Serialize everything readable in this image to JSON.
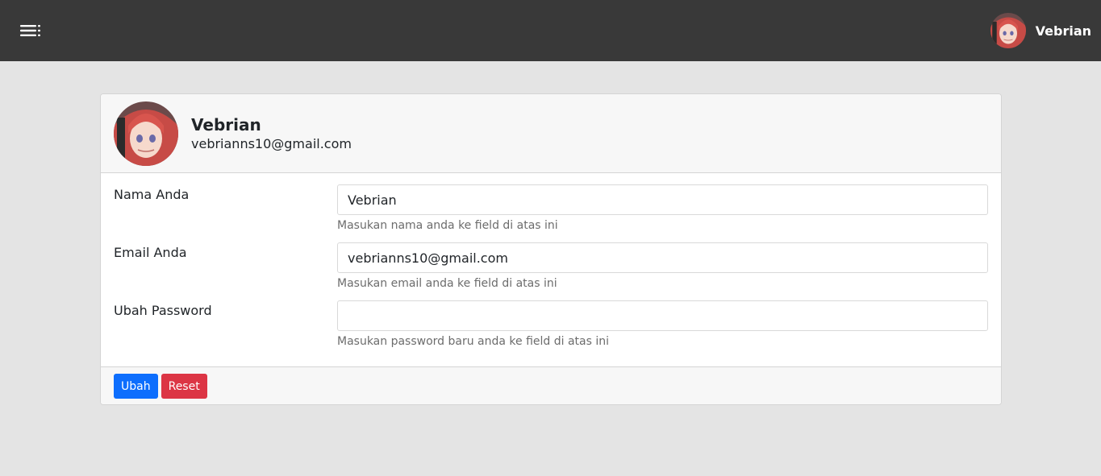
{
  "topbar": {
    "menu_icon": "hamburger-menu-icon",
    "user_name": "Vebrian",
    "background": "#393939"
  },
  "profile": {
    "name": "Vebrian",
    "email": "vebrianns10@gmail.com"
  },
  "form": {
    "name_label": "Nama Anda",
    "name_value": "Vebrian",
    "name_help": "Masukan nama anda ke field di atas ini",
    "email_label": "Email Anda",
    "email_value": "vebrianns10@gmail.com",
    "email_help": "Masukan email anda ke field di atas ini",
    "password_label": "Ubah Password",
    "password_value": "",
    "password_help": "Masukan password baru anda ke field di atas ini"
  },
  "buttons": {
    "submit_label": "Ubah",
    "reset_label": "Reset",
    "submit_color": "#0d6efd",
    "reset_color": "#dc3545"
  }
}
